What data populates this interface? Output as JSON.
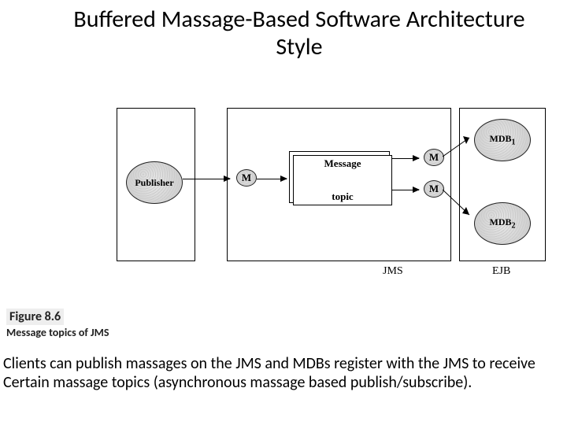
{
  "title_line": "Buffered Massage-Based Software Architecture Style",
  "diagram": {
    "publisher": "Publisher",
    "mdb1": "MDB",
    "mdb1_sub": "1",
    "mdb2": "MDB",
    "mdb2_sub": "2",
    "m": "M",
    "message_label": "Message",
    "topic_label": "topic",
    "jms_label": "JMS",
    "ejb_label": "EJB"
  },
  "figure": {
    "num": "Figure 8.6",
    "caption": "Message topics of JMS"
  },
  "body_text": "Clients can publish massages on the JMS and MDBs register with the JMS to receive Certain massage topics (asynchronous massage based publish/subscribe)."
}
